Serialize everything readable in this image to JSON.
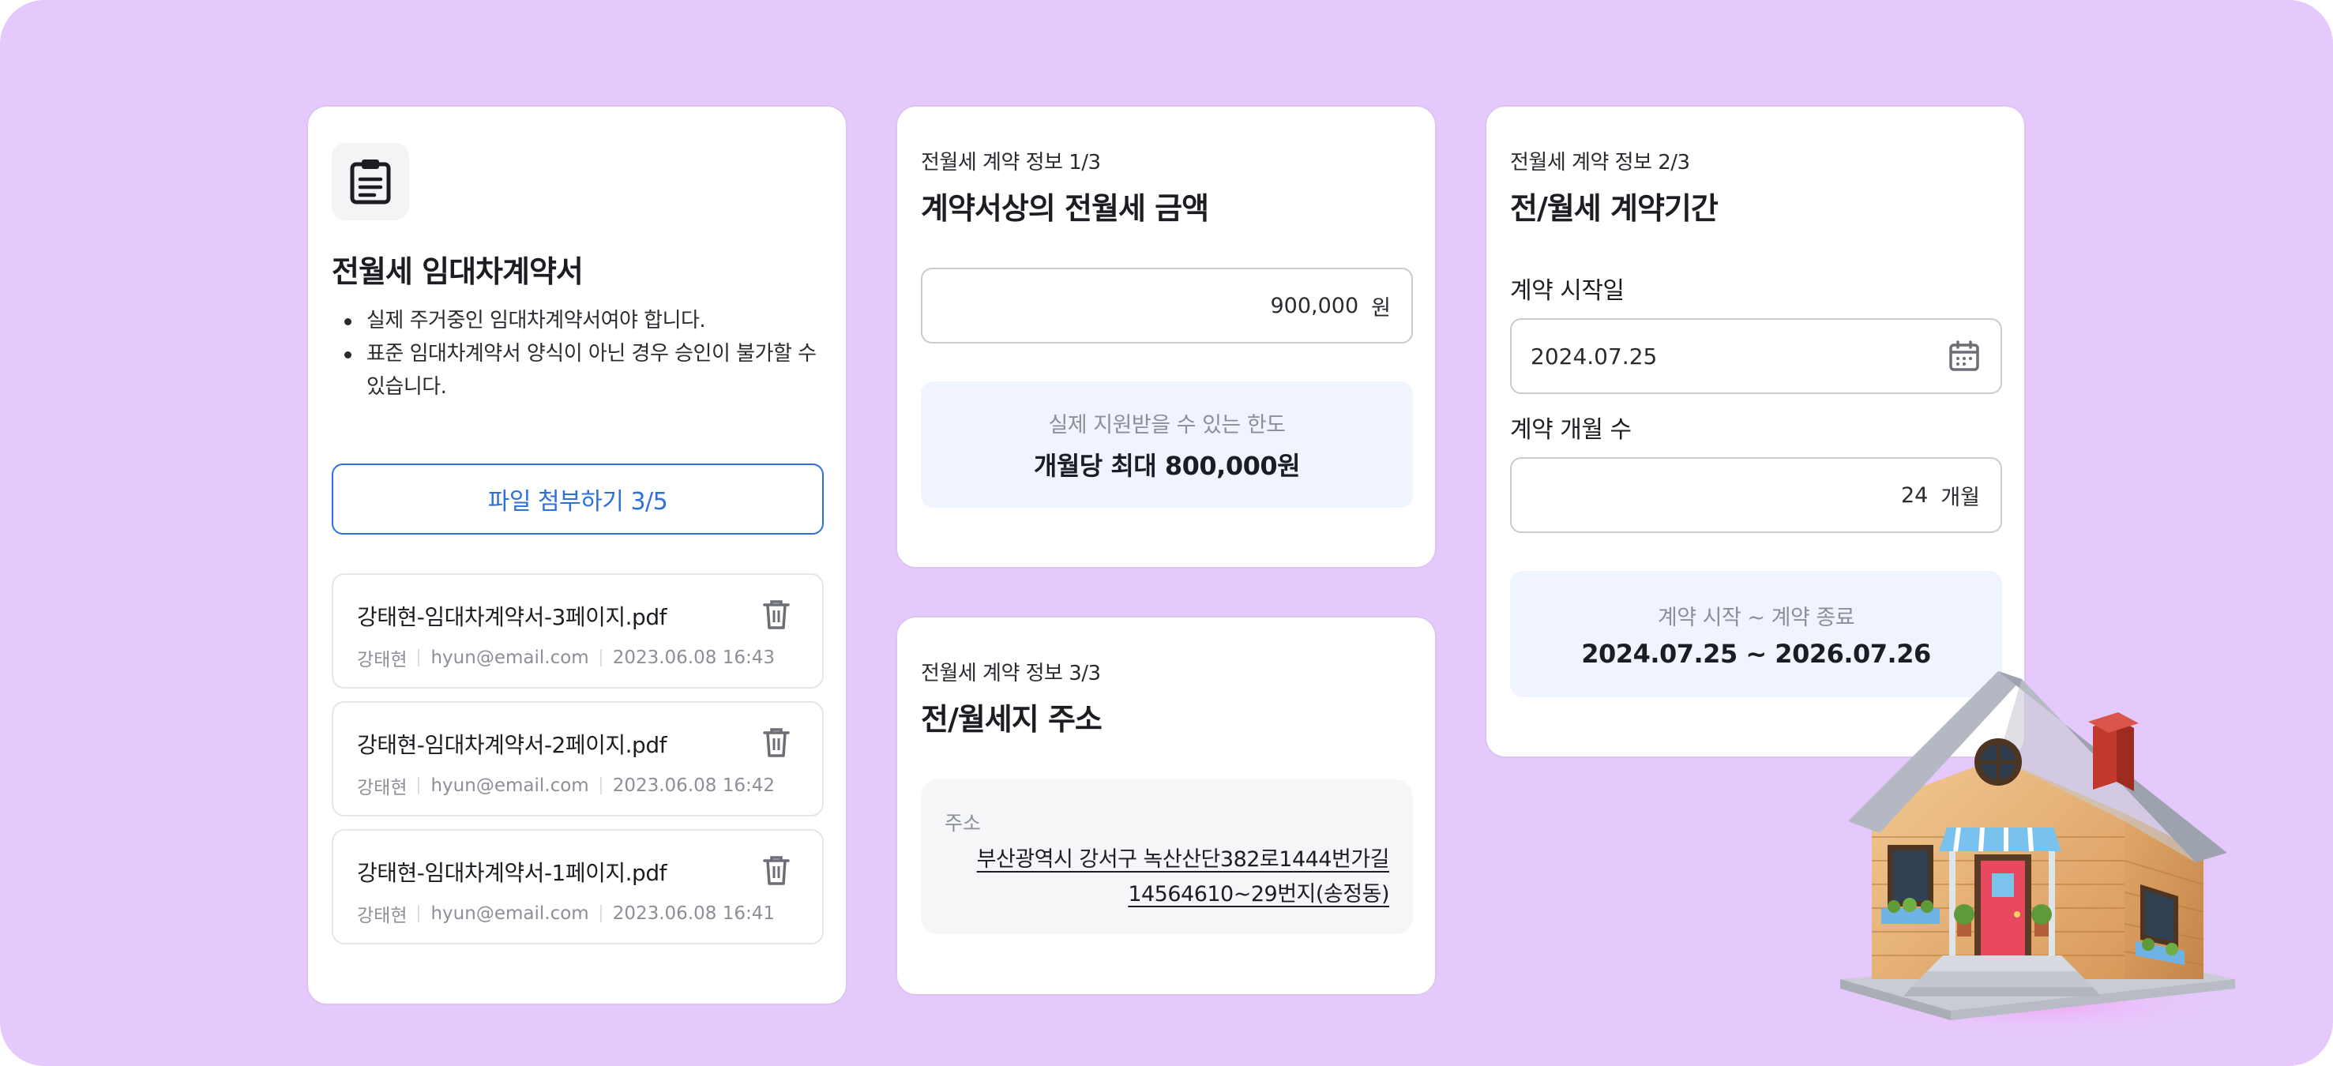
{
  "doc_card": {
    "title": "전월세 임대차계약서",
    "icon": "clipboard-icon",
    "bullets": [
      "실제 주거중인 임대차계약서여야 합니다.",
      "표준 임대차계약서 양식이 아닌 경우 승인이 불가할 수 있습니다."
    ],
    "attach_button": "파일 첨부하기 3/5",
    "files": [
      {
        "name": "강태현-임대차계약서-3페이지.pdf",
        "owner": "강태현",
        "email": "hyun@email.com",
        "datetime": "2023.06.08 16:43"
      },
      {
        "name": "강태현-임대차계약서-2페이지.pdf",
        "owner": "강태현",
        "email": "hyun@email.com",
        "datetime": "2023.06.08 16:42"
      },
      {
        "name": "강태현-임대차계약서-1페이지.pdf",
        "owner": "강태현",
        "email": "hyun@email.com",
        "datetime": "2023.06.08 16:41"
      }
    ]
  },
  "amount_card": {
    "step": "전월세 계약 정보 1/3",
    "title": "계약서상의 전월세 금액",
    "amount_value": "900,000",
    "amount_unit": "원",
    "limit_label": "실제 지원받을 수 있는 한도",
    "limit_value": "개월당 최대 800,000원"
  },
  "period_card": {
    "step": "전월세 계약 정보 2/3",
    "title": "전/월세 계약기간",
    "start_label": "계약 시작일",
    "start_value": "2024.07.25",
    "months_label": "계약 개월 수",
    "months_value": "24",
    "months_unit": "개월",
    "range_label": "계약 시작 ~ 계약 종료",
    "range_value": "2024.07.25 ~ 2026.07.26"
  },
  "address_card": {
    "step": "전월세 계약 정보 3/3",
    "title": "전/월세지 주소",
    "address_label": "주소",
    "address_line1": "부산광역시 강서구 녹산산단382로1444번가길",
    "address_line2": "14564610~29번지(송정동)"
  },
  "colors": {
    "background": "#e6c9fc",
    "accent": "#2d6fe0",
    "info_box": "#f0f4ff"
  }
}
